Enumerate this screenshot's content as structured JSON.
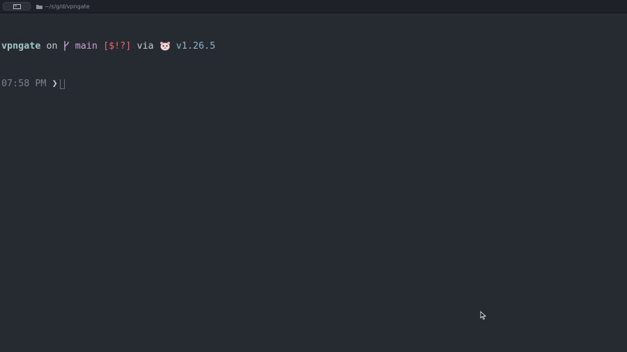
{
  "tabbar": {
    "terminal_tab_icon": "terminal-icon",
    "folder_icon": "folder-icon",
    "path": "~/s/g/d/vpngate"
  },
  "prompt": {
    "directory": "vpngate",
    "on_word": "on",
    "git_icon": "git-branch-icon",
    "branch": "main",
    "status": "[$!?]",
    "via_word": "via",
    "runtime_icon": "gopher-icon",
    "version": "v1.26.5",
    "time": "07:58 PM",
    "prompt_char": "❯"
  },
  "colors": {
    "background": "#262a31",
    "directory": "#9fc7c7",
    "status": "#e06c75",
    "branch": "#c9a3d3",
    "version": "#8fb5c9"
  }
}
